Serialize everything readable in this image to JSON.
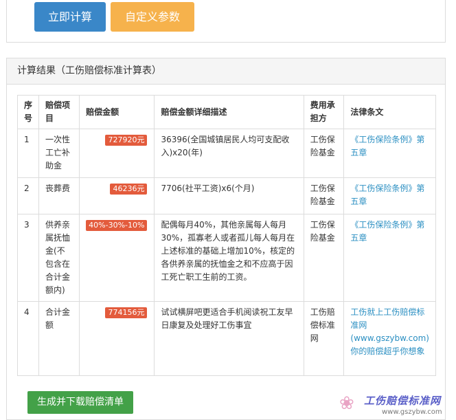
{
  "toolbar": {
    "calc_label": "立即计算",
    "custom_label": "自定义参数"
  },
  "result": {
    "title": "计算结果（工伤赔偿标准计算表）",
    "columns": [
      "序号",
      "赔偿项目",
      "赔偿金额",
      "赔偿金额详细描述",
      "费用承担方",
      "法律条文"
    ],
    "rows": [
      {
        "no": "1",
        "item": "一次性工亡补助金",
        "amount": "727920元",
        "desc": "36396(全国城镇居民人均可支配收入)x20(年)",
        "payer": "工伤保险基金",
        "law": "《工伤保险条例》第五章"
      },
      {
        "no": "2",
        "item": "丧葬费",
        "amount": "46236元",
        "desc": "7706(社平工资)x6(个月)",
        "payer": "工伤保险基金",
        "law": "《工伤保险条例》第五章"
      },
      {
        "no": "3",
        "item": "供养亲属抚恤金(不包含在合计金额内)",
        "amount": "40%-30%-10%",
        "desc": "配偶每月40%，其他亲属每人每月30%，孤寡老人或者孤儿每人每月在上述标准的基础上增加10%，核定的各供养亲属的抚恤金之和不应高于因工死亡职工生前的工资。",
        "payer": "工伤保险基金",
        "law": "《工伤保险条例》第五章"
      },
      {
        "no": "4",
        "item": "合计金额",
        "amount": "774156元",
        "desc": "试试横屏吧更适合手机阅读祝工友早日康复及处理好工伤事宜",
        "payer": "工伤赔偿标准网",
        "law": "工伤就上工伤赔偿标准网(www.gszybw.com)你的赔偿超乎你想象"
      }
    ]
  },
  "download_label": "生成并下载赔偿清单",
  "watermark": {
    "title": "工伤赔偿标准网",
    "url": "www.gszybw.com"
  },
  "colors": {
    "primary": "#3a87c8",
    "warning": "#f6b24c",
    "success": "#43a148",
    "badge": "#e35b3c",
    "link": "#2b8fc2"
  }
}
